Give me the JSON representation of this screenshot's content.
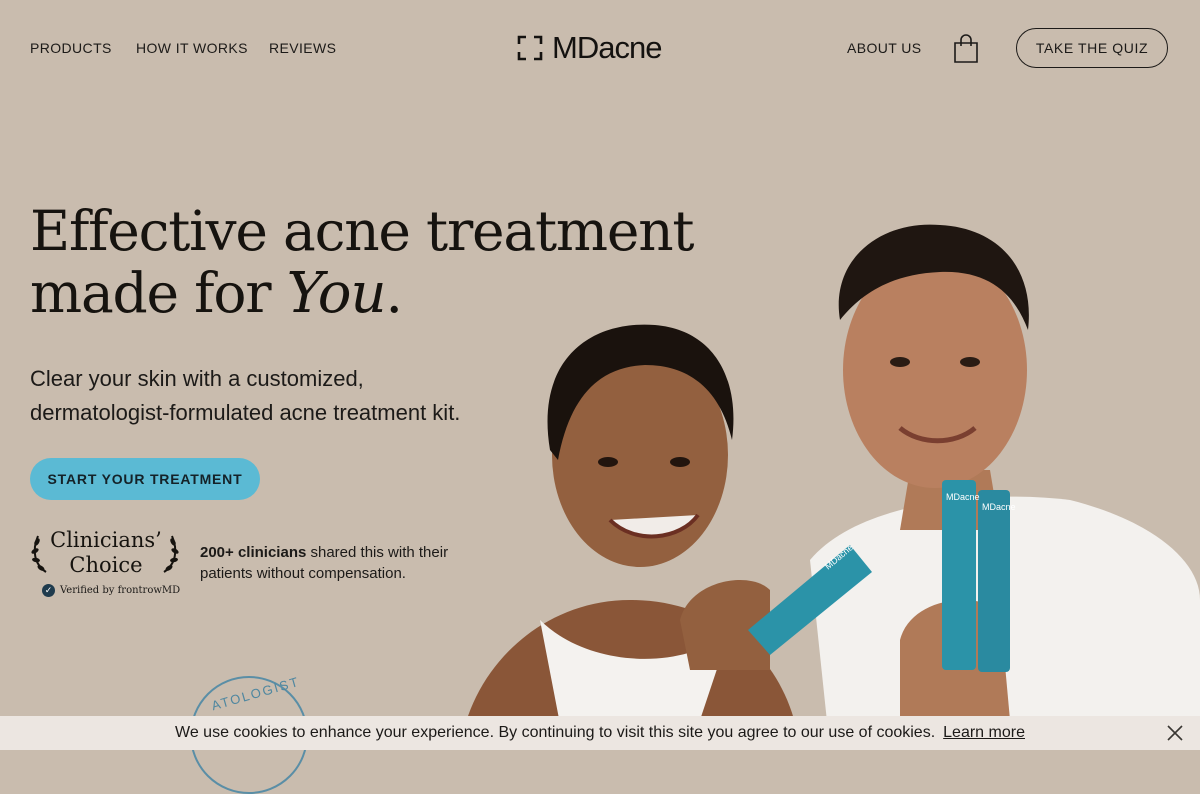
{
  "nav": {
    "links": [
      "PRODUCTS",
      "HOW IT WORKS",
      "REVIEWS"
    ],
    "logo_text": "MDacne",
    "about": "ABOUT US",
    "quiz_button": "TAKE THE QUIZ"
  },
  "hero": {
    "headline_line1": "Effective acne treatment",
    "headline_line2_prefix": "made for",
    "headline_script": "You",
    "headline_period": ".",
    "subtitle_line1": "Clear your skin with a customized,",
    "subtitle_line2": "dermatologist-formulated acne treatment kit.",
    "cta": "START YOUR TREATMENT"
  },
  "badge": {
    "line1": "Clinicians’",
    "line2": "Choice",
    "verified": "Verified by frontrowMD"
  },
  "clinicians": {
    "bold": "200+ clinicians",
    "rest": " shared this with their patients without compensation."
  },
  "stamp": {
    "text": "ATOLOGIST"
  },
  "tube_label": "MDacne",
  "cookie": {
    "message": "We use cookies to enhance your experience. By continuing to visit this site you agree to our use of cookies.",
    "link": "Learn more"
  },
  "colors": {
    "background": "#c9bcae",
    "cta": "#5bbad4",
    "cookie_bar": "#ece6e1",
    "tube": "#2b93a8"
  },
  "icons": [
    "logo-mark-icon",
    "shopping-bag-icon",
    "check-icon",
    "laurel-icon",
    "close-icon"
  ]
}
